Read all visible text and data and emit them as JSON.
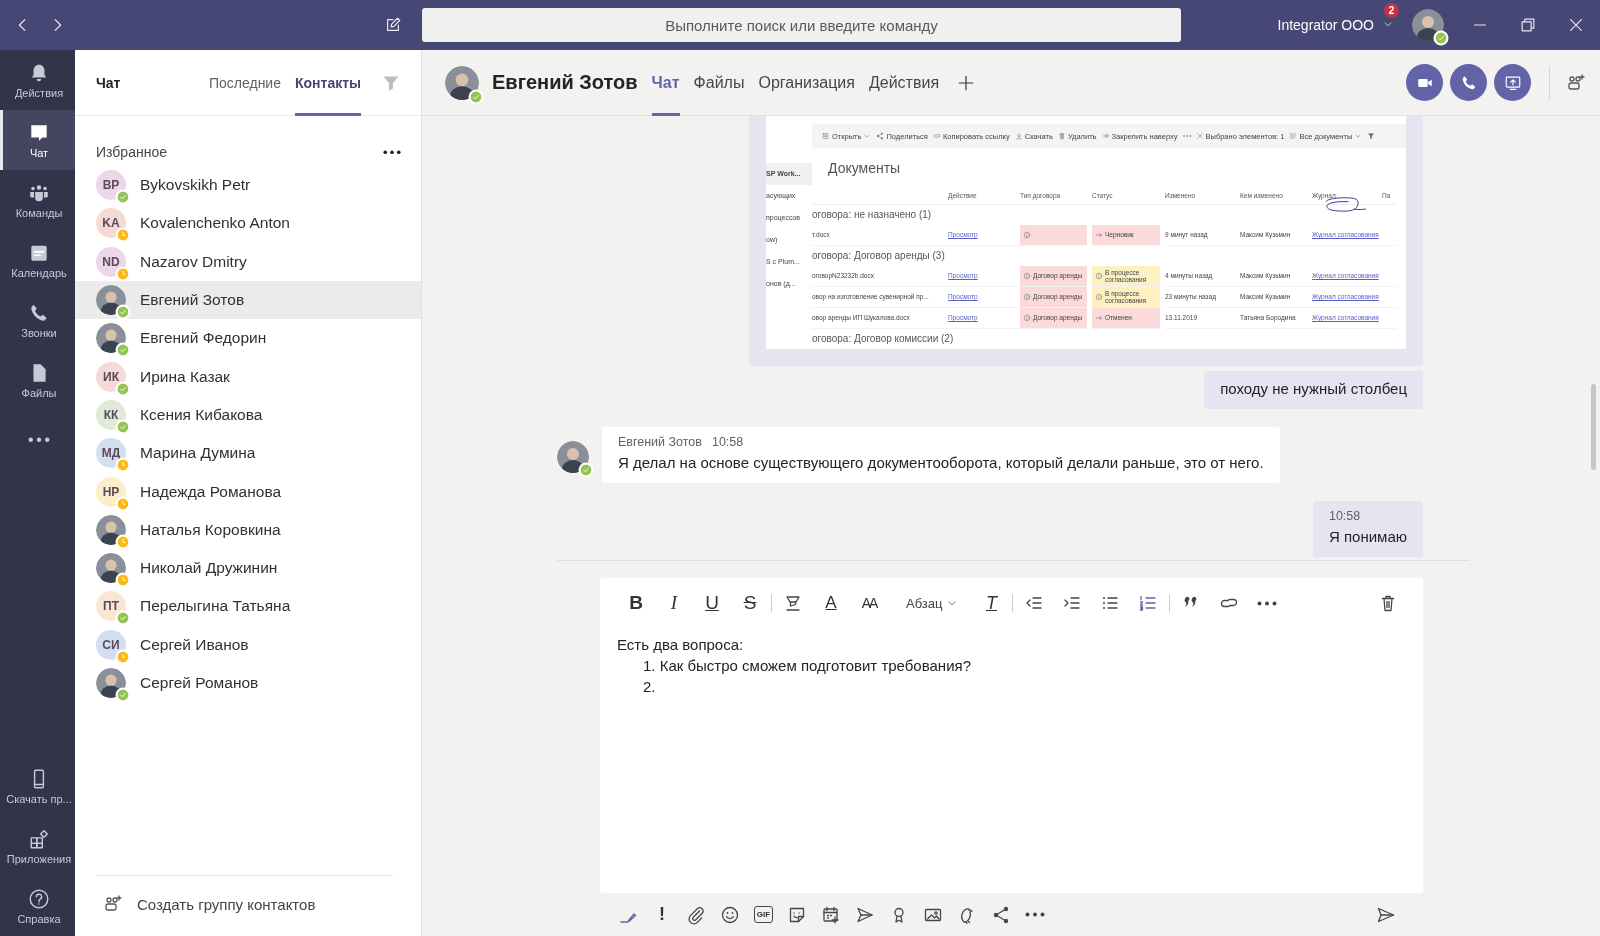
{
  "title_bar": {
    "search_placeholder": "Выполните поиск или введите команду",
    "account": "Integrator OOO",
    "badge": "2",
    "away": false
  },
  "rail": {
    "items": [
      {
        "label": "Действия",
        "kind": "bell",
        "selected": false
      },
      {
        "label": "Чат",
        "kind": "chat",
        "selected": true
      },
      {
        "label": "Команды",
        "kind": "teams",
        "selected": false
      },
      {
        "label": "Календарь",
        "kind": "calendar",
        "selected": false
      },
      {
        "label": "Звонки",
        "kind": "phone",
        "selected": false
      },
      {
        "label": "Файлы",
        "kind": "file",
        "selected": false
      },
      {
        "kind": "more",
        "selected": false
      }
    ],
    "bottom_items": [
      {
        "label": "Скачать пр...",
        "kind": "mobile"
      },
      {
        "label": "Приложения",
        "kind": "apps"
      },
      {
        "label": "Справка",
        "kind": "help"
      }
    ]
  },
  "contacts_panel": {
    "title": "Чат",
    "tabs": [
      {
        "label": "Последние",
        "selected": false
      },
      {
        "label": "Контакты",
        "selected": true
      }
    ],
    "group": "Избранное",
    "contacts": [
      {
        "name": "Bykovskikh Petr",
        "kind": "initials",
        "initials": "BP",
        "color": "#ecd6ea",
        "away": false,
        "selected": false
      },
      {
        "name": "Kovalenchenko Anton",
        "kind": "initials",
        "initials": "KA",
        "color": "#f6dad4",
        "away": true,
        "selected": false
      },
      {
        "name": "Nazarov Dmitry",
        "kind": "initials",
        "initials": "ND",
        "color": "#ecd6ea",
        "away": true,
        "selected": false
      },
      {
        "name": "Евгений Зотов",
        "kind": "photo",
        "away": false,
        "selected": true
      },
      {
        "name": "Евгений Федорин",
        "kind": "photo",
        "away": false,
        "selected": false
      },
      {
        "name": "Ирина Казак",
        "kind": "initials",
        "initials": "ИК",
        "color": "#f6dada",
        "away": false,
        "selected": false
      },
      {
        "name": "Ксения Кибакова",
        "kind": "initials",
        "initials": "КК",
        "color": "#e1ead8",
        "away": false,
        "selected": false
      },
      {
        "name": "Марина Думина",
        "kind": "initials",
        "initials": "МД",
        "color": "#d3def0",
        "away": true,
        "selected": false
      },
      {
        "name": "Надежда Романова",
        "kind": "initials",
        "initials": "НР",
        "color": "#fbeecb",
        "away": true,
        "selected": false
      },
      {
        "name": "Наталья Коровкина",
        "kind": "photo",
        "away": true,
        "selected": false
      },
      {
        "name": "Николай Дружинин",
        "kind": "photo",
        "away": true,
        "selected": false
      },
      {
        "name": "Перелыгина Татьяна",
        "kind": "initials",
        "initials": "ПТ",
        "color": "#f9e7d4",
        "away": false,
        "selected": false
      },
      {
        "name": "Сергей Иванов",
        "kind": "initials",
        "initials": "СИ",
        "color": "#d3def0",
        "away": true,
        "selected": false
      },
      {
        "name": "Сергей Романов",
        "kind": "photo",
        "away": false,
        "selected": false
      }
    ],
    "create_group": "Создать группу контактов"
  },
  "chat_header": {
    "name": "Евгений Зотов",
    "away": false,
    "tabs": [
      {
        "label": "Чат",
        "selected": true
      },
      {
        "label": "Файлы",
        "selected": false
      },
      {
        "label": "Организация",
        "selected": false
      },
      {
        "label": "Действия",
        "selected": false
      }
    ]
  },
  "messages": [
    {
      "kind": "screenshot",
      "own": true,
      "document": {
        "toolbar": [
          {
            "kind": "open",
            "label": "Открыть",
            "menu": true
          },
          {
            "kind": "share",
            "label": "Поделиться",
            "menu": false
          },
          {
            "kind": "link",
            "label": "Копировать ссылку",
            "menu": false
          },
          {
            "kind": "download",
            "label": "Скачать",
            "menu": false
          },
          {
            "kind": "trash",
            "label": "Удалить",
            "menu": false
          },
          {
            "kind": "pin",
            "label": "Закрепить наверху",
            "menu": false
          },
          {
            "kind": "more",
            "menu": false
          },
          {
            "kind": "close",
            "label": "Выбрано элементов: 1",
            "menu": false
          },
          {
            "kind": "view",
            "label": "Все документы",
            "menu": true
          },
          {
            "kind": "filter",
            "menu": false
          }
        ],
        "nav": [
          {
            "label": "SP Work...",
            "selected": true
          },
          {
            "label": "асующих",
            "selected": false
          },
          {
            "label": "процессов",
            "selected": false
          },
          {
            "label": "ow)",
            "selected": false
          },
          {
            "label": "S с Plum...",
            "selected": false
          },
          {
            "label": "онов (д...",
            "selected": false
          }
        ],
        "title": "Документы",
        "columns": [
          "Действие",
          "Тип договора",
          "Статус",
          "Изменено",
          "Кем изменено",
          "Журнал",
          "Па"
        ],
        "groups": [
          {
            "title": "оговора: не назначено (1)",
            "rows": [
              {
                "name": "т.docx",
                "action": "Просмотр",
                "type": {
                  "color": "#fadada"
                },
                "status": {
                  "kind": "arrow",
                  "text": "Черновик",
                  "color": "#fadada"
                },
                "modified": "9 минут назад",
                "modified_by": "Максим Кузьмин",
                "journal": "Журнал согласования"
              }
            ]
          },
          {
            "title": "оговора: Договор аренды (3)",
            "rows": [
              {
                "name": "оговорN23232b.docx",
                "action": "Просмотр",
                "type": {
                  "text": "Договор аренды",
                  "color": "#fadada"
                },
                "status": {
                  "kind": "info",
                  "text": "В процессе согласования",
                  "color": "#fdf1c4"
                },
                "modified": "4 минуты назад",
                "modified_by": "Максим Кузьмин",
                "journal": "Журнал согласования"
              },
              {
                "name": "овор на изготовление сувенирной пр...",
                "action": "Просмотр",
                "type": {
                  "text": "Договор аренды",
                  "color": "#fadada"
                },
                "status": {
                  "kind": "info",
                  "text": "В процессе согласования",
                  "color": "#fdf1c4"
                },
                "modified": "23 минуты назад",
                "modified_by": "Максим Кузьмин",
                "journal": "Журнал согласования"
              },
              {
                "name": "овор аренды ИП Шукалова.docx",
                "action": "Просмотр",
                "type": {
                  "text": "Договор аренды",
                  "color": "#fadada"
                },
                "status": {
                  "kind": "arrow",
                  "text": "Отменен",
                  "color": "#fadada"
                },
                "modified": "13.11.2019",
                "modified_by": "Татьяна Бородина",
                "journal": "Журнал согласования"
              }
            ]
          },
          {
            "title": "оговора: Договор комиссии (2)"
          }
        ]
      }
    },
    {
      "kind": "text",
      "own": true,
      "text": "походу не нужный столбец"
    },
    {
      "kind": "text",
      "own": false,
      "author": "Евгений Зотов",
      "time": "10:58",
      "away": false,
      "text": "Я делал на основе существующего документооборота, который делали раньше, это от него."
    },
    {
      "kind": "text",
      "own": true,
      "time": "10:58",
      "text": "Я понимаю"
    }
  ],
  "composer": {
    "tools": [
      {
        "kind": "bold",
        "glyph": "B",
        "on": false
      },
      {
        "kind": "italic",
        "glyph": "I",
        "on": false
      },
      {
        "kind": "underline",
        "glyph": "U",
        "on": false
      },
      {
        "kind": "strike",
        "glyph": "S",
        "on": false
      },
      {
        "kind": "sep"
      },
      {
        "kind": "highlight",
        "on": false
      },
      {
        "kind": "font-color",
        "glyph": "A",
        "on": false
      },
      {
        "kind": "font-size",
        "glyph": "AA",
        "on": false
      },
      {
        "kind": "dropdown",
        "label": "Абзац"
      },
      {
        "kind": "clear-format",
        "glyph": "T",
        "on": false
      },
      {
        "kind": "sep"
      },
      {
        "kind": "outdent",
        "on": false
      },
      {
        "kind": "indent",
        "on": false
      },
      {
        "kind": "bullets",
        "on": false
      },
      {
        "kind": "numbering",
        "on": true
      },
      {
        "kind": "sep"
      },
      {
        "kind": "quote",
        "on": false
      },
      {
        "kind": "link",
        "on": false
      },
      {
        "kind": "more",
        "on": false
      }
    ],
    "lines": [
      {
        "kind": "paragraph",
        "text": "Есть два вопроса:"
      },
      {
        "kind": "list_item",
        "number": "1.",
        "text": "Как быстро сможем подготовит требования?"
      },
      {
        "kind": "list_item",
        "number": "2."
      }
    ],
    "bottom_tools": [
      {
        "kind": "format"
      },
      {
        "kind": "important",
        "glyph": "!"
      },
      {
        "kind": "attach"
      },
      {
        "kind": "emoji"
      },
      {
        "kind": "gif",
        "glyph": "GIF"
      },
      {
        "kind": "sticker"
      },
      {
        "kind": "meeting"
      },
      {
        "kind": "stream"
      },
      {
        "kind": "praise"
      },
      {
        "kind": "image"
      },
      {
        "kind": "bird"
      },
      {
        "kind": "share"
      },
      {
        "kind": "more"
      }
    ]
  }
}
